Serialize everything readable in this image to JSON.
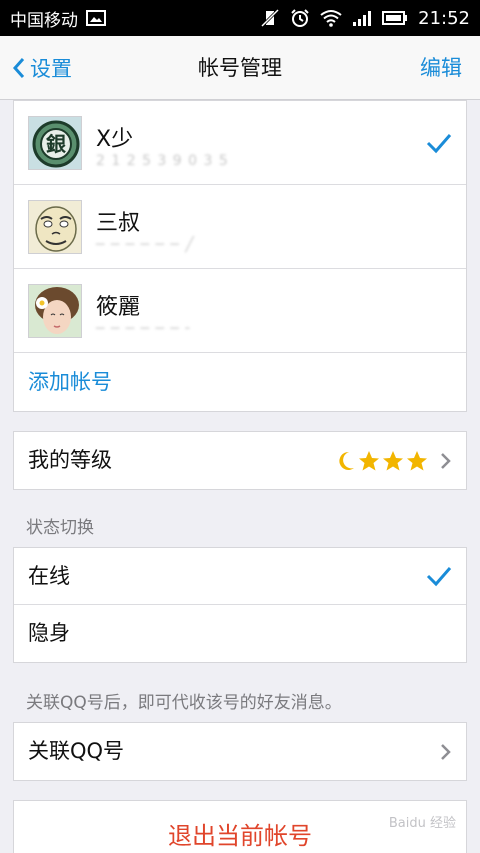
{
  "status_bar": {
    "carrier": "中国移动",
    "time": "21:52"
  },
  "nav": {
    "back_label": "设置",
    "title": "帐号管理",
    "edit_label": "编辑"
  },
  "accounts": [
    {
      "name": "X少",
      "sub": "2 1 2 5 3 9 0 3 5",
      "selected": true
    },
    {
      "name": "三叔",
      "sub": "─ ─ ─ ─ ─ ─ ╱",
      "selected": false
    },
    {
      "name": "筱麗",
      "sub": "─ ─ ─ ─ ─ ─ ╴",
      "selected": false
    }
  ],
  "add_account_label": "添加帐号",
  "level": {
    "label": "我的等级",
    "icons": [
      "moon-icon",
      "star-icon",
      "star-icon",
      "star-icon"
    ]
  },
  "status_section": {
    "header": "状态切换",
    "options": [
      {
        "label": "在线",
        "selected": true
      },
      {
        "label": "隐身",
        "selected": false
      }
    ]
  },
  "link_qq": {
    "note": "关联QQ号后，即可代收该号的好友消息。",
    "label": "关联QQ号"
  },
  "logout_label": "退出当前帐号",
  "watermark": "Baidu 经验",
  "colors": {
    "accent": "#1a8cd8",
    "danger": "#e0452b",
    "background": "#efeff4",
    "star": "#f2b500"
  }
}
